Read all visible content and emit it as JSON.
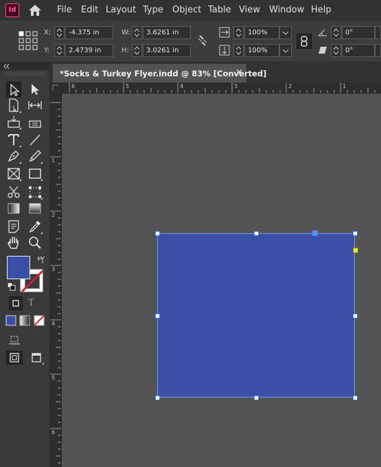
{
  "app": {
    "logo_text": "Id"
  },
  "menu": [
    "File",
    "Edit",
    "Layout",
    "Type",
    "Object",
    "Table",
    "View",
    "Window",
    "Help"
  ],
  "control": {
    "x_label": "X:",
    "x_value": "-4.375 in",
    "y_label": "Y:",
    "y_value": "2.4739 in",
    "w_label": "W:",
    "w_value": "3.6261 in",
    "h_label": "H:",
    "h_value": "3.0261 in",
    "scale_x": "100%",
    "scale_y": "100%",
    "rotate": "0°",
    "shear": "0°"
  },
  "document": {
    "tab_title": "*Socks & Turkey Flyer.indd @ 83% [Converted]",
    "close_glyph": "×"
  },
  "ruler": {
    "horizontal": [
      "6",
      "5",
      "4",
      "3",
      "2",
      "1"
    ],
    "vertical": [
      "1",
      "2",
      "3",
      "4",
      "5",
      "6"
    ]
  },
  "colors": {
    "fill": "#3a4fa5",
    "accent": "#4f8ff7",
    "stroke_none": "#c8262c"
  },
  "tools": {
    "text_mode_glyph": "T"
  }
}
